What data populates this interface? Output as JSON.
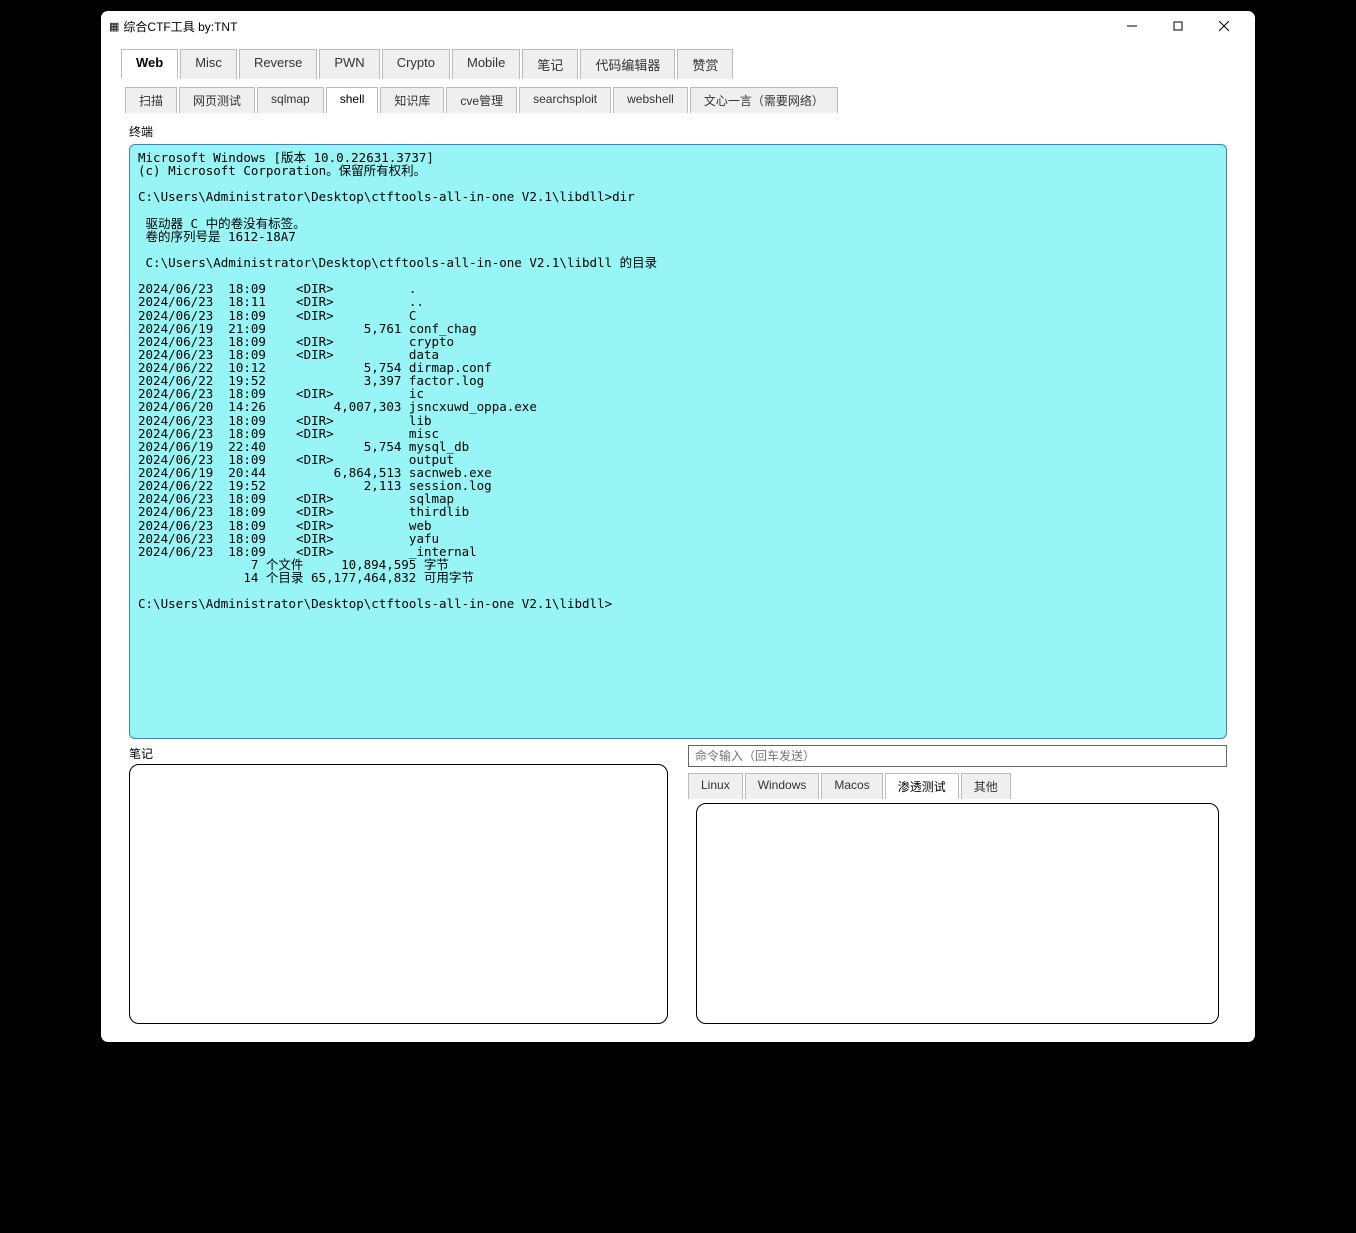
{
  "window": {
    "title": "综合CTF工具  by:TNT"
  },
  "maintabs": {
    "items": [
      "Web",
      "Misc",
      "Reverse",
      "PWN",
      "Crypto",
      "Mobile",
      "笔记",
      "代码编辑器",
      "赞赏"
    ],
    "active_index": 0
  },
  "subtabs": {
    "items": [
      "扫描",
      "网页测试",
      "sqlmap",
      "shell",
      "知识库",
      "cve管理",
      "searchsploit",
      "webshell",
      "文心一言（需要网络）"
    ],
    "active_index": 3
  },
  "labels": {
    "terminal": "终端",
    "notes": "笔记"
  },
  "terminal": {
    "content": "Microsoft Windows [版本 10.0.22631.3737]\n(c) Microsoft Corporation。保留所有权利。\n\nC:\\Users\\Administrator\\Desktop\\ctftools-all-in-one V2.1\\libdll>dir\n\n 驱动器 C 中的卷没有标签。\n 卷的序列号是 1612-18A7\n\n C:\\Users\\Administrator\\Desktop\\ctftools-all-in-one V2.1\\libdll 的目录\n\n2024/06/23  18:09    <DIR>          .\n2024/06/23  18:11    <DIR>          ..\n2024/06/23  18:09    <DIR>          C\n2024/06/19  21:09             5,761 conf_chag\n2024/06/23  18:09    <DIR>          crypto\n2024/06/23  18:09    <DIR>          data\n2024/06/22  10:12             5,754 dirmap.conf\n2024/06/22  19:52             3,397 factor.log\n2024/06/23  18:09    <DIR>          ic\n2024/06/20  14:26         4,007,303 jsncxuwd_oppa.exe\n2024/06/23  18:09    <DIR>          lib\n2024/06/23  18:09    <DIR>          misc\n2024/06/19  22:40             5,754 mysql_db\n2024/06/23  18:09    <DIR>          output\n2024/06/19  20:44         6,864,513 sacnweb.exe\n2024/06/22  19:52             2,113 session.log\n2024/06/23  18:09    <DIR>          sqlmap\n2024/06/23  18:09    <DIR>          thirdlib\n2024/06/23  18:09    <DIR>          web\n2024/06/23  18:09    <DIR>          yafu\n2024/06/23  18:09    <DIR>          _internal\n               7 个文件     10,894,595 字节\n              14 个目录 65,177,464,832 可用字节\n\nC:\\Users\\Administrator\\Desktop\\ctftools-all-in-one V2.1\\libdll>"
  },
  "cmd_input": {
    "placeholder": "命令输入（回车发送）"
  },
  "ostabs": {
    "items": [
      "Linux",
      "Windows",
      "Macos",
      "渗透测试",
      "其他"
    ],
    "active_index": 3
  }
}
